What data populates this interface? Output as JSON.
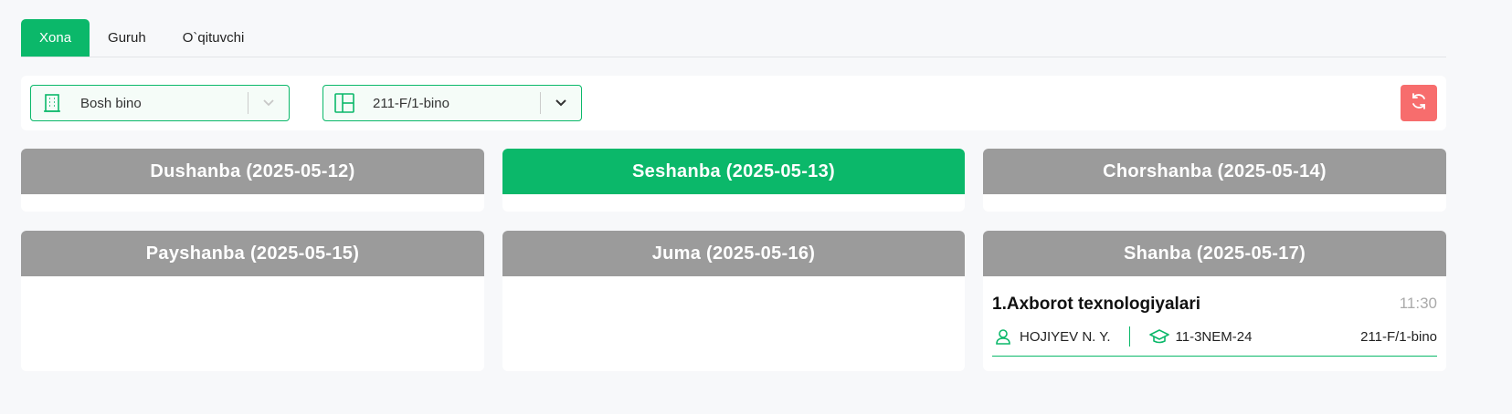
{
  "tabs": [
    {
      "label": "Xona",
      "active": true
    },
    {
      "label": "Guruh",
      "active": false
    },
    {
      "label": "O`qituvchi",
      "active": false
    }
  ],
  "filters": {
    "building": {
      "value": "Bosh bino",
      "icon": "building-icon"
    },
    "room": {
      "value": "211-F/1-bino",
      "icon": "layout-icon"
    },
    "refresh_icon": "refresh-icon"
  },
  "days": [
    {
      "label": "Dushanba (2025-05-12)",
      "active": false
    },
    {
      "label": "Seshanba (2025-05-13)",
      "active": true
    },
    {
      "label": "Chorshanba (2025-05-14)",
      "active": false
    },
    {
      "label": "Payshanba (2025-05-15)",
      "active": false
    },
    {
      "label": "Juma (2025-05-16)",
      "active": false
    },
    {
      "label": "Shanba (2025-05-17)",
      "active": false
    }
  ],
  "lesson": {
    "title": "1.Axborot texnologiyalari",
    "time": "11:30",
    "teacher": "HOJIYEV N. Y.",
    "group": "11-3NEM-24",
    "room": "211-F/1-bino"
  },
  "colors": {
    "accent": "#0bb86a",
    "header_gray": "#9b9b9b",
    "refresh": "#f76d6d"
  }
}
